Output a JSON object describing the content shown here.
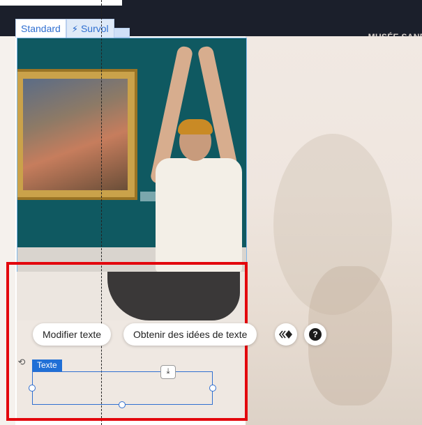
{
  "header": {
    "site_title": "MUSÉE SANDE"
  },
  "state_tabs": [
    {
      "label": "Standard",
      "active": true
    },
    {
      "label": "Survol",
      "icon": "lightning-icon",
      "active": false
    }
  ],
  "toolbar": {
    "edit_text_label": "Modifier texte",
    "ai_ideas_label": "Obtenir des idées de texte",
    "animation_icon": "animation-icon",
    "help_icon": "help-icon",
    "help_glyph": "?"
  },
  "text_element": {
    "tag_label": "Texte",
    "value": "",
    "rotate_icon": "rotate-icon",
    "download_icon": "download-icon"
  },
  "colors": {
    "accent": "#1f6fd6",
    "highlight": "#e3070d",
    "topbar": "#1b1f2b"
  }
}
